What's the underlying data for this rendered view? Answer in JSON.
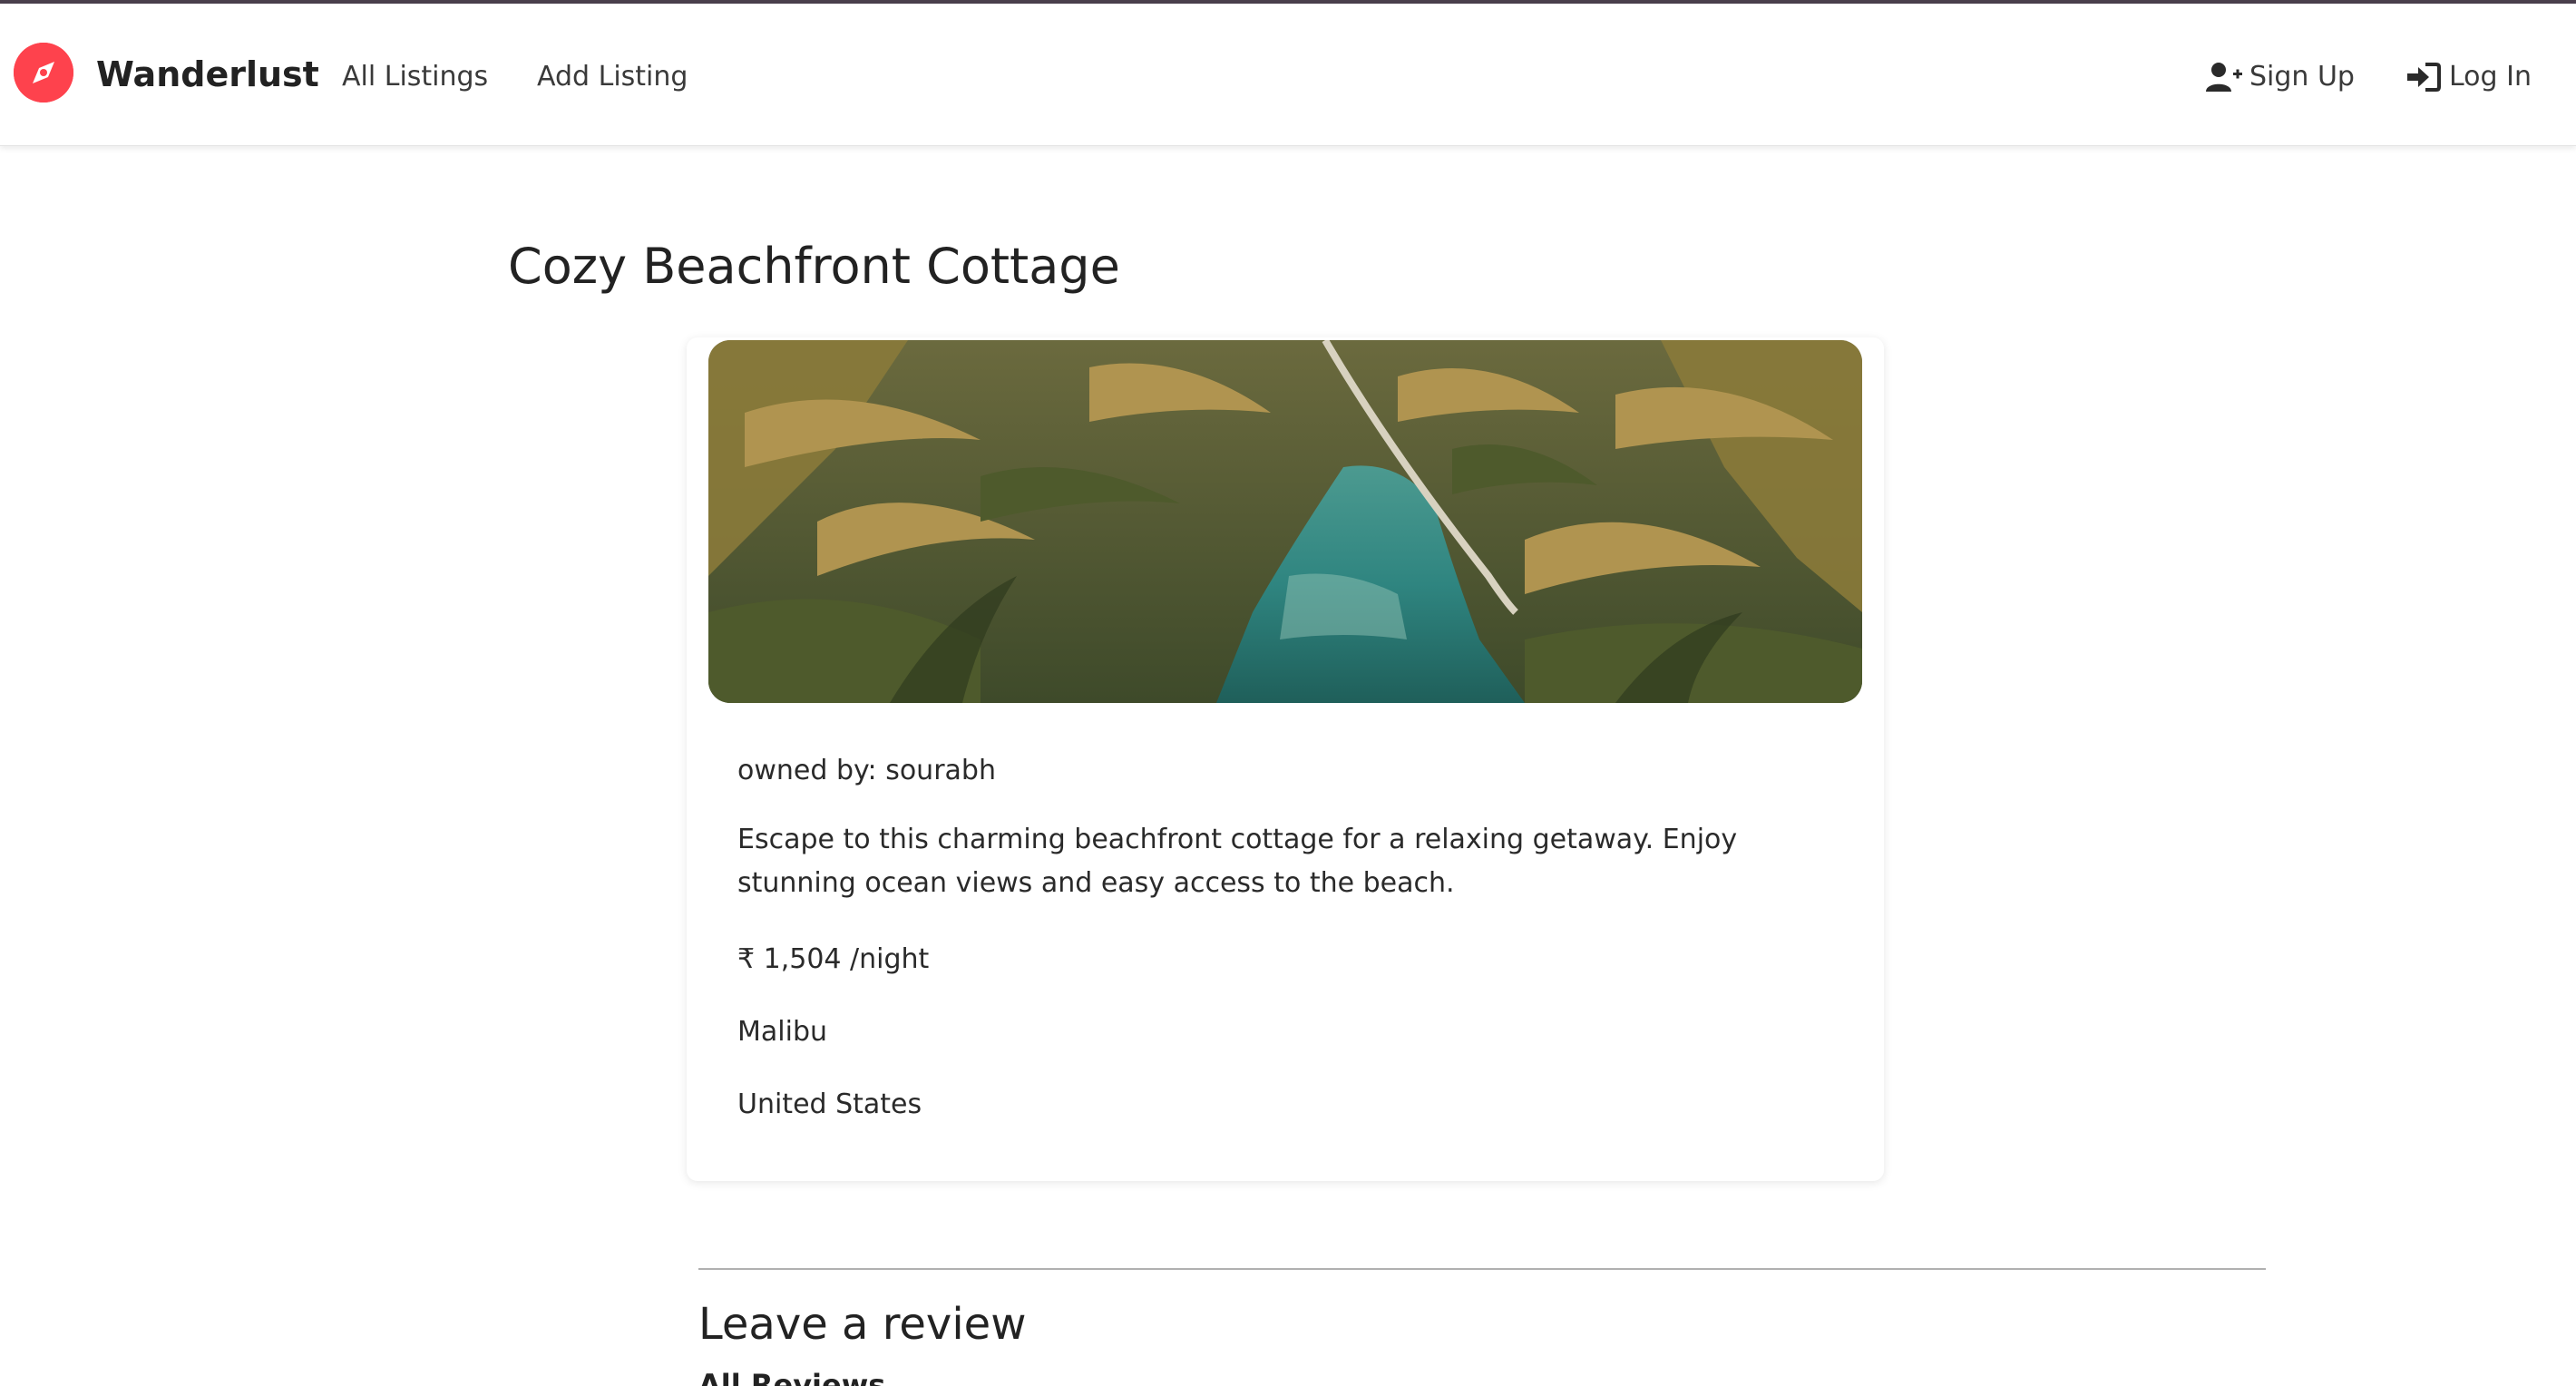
{
  "navbar": {
    "brand": "Wanderlust",
    "links": [
      "All Listings",
      "Add Listing"
    ],
    "signup_label": "Sign Up",
    "login_label": "Log In",
    "brand_icon": "compass-icon",
    "signup_icon": "user-plus-icon",
    "login_icon": "sign-in-icon",
    "accent_color": "#fe424d"
  },
  "listing": {
    "title": "Cozy Beachfront Cottage",
    "owner": "owned by: sourabh",
    "description": "Escape to this charming beachfront cottage for a relaxing getaway. Enjoy stunning ocean views and easy access to the beach.",
    "price": "₹ 1,504 /night",
    "location": "Malibu",
    "country": "United States"
  },
  "reviews": {
    "heading": "Leave a review",
    "all_reviews_label": "All Reviews"
  }
}
